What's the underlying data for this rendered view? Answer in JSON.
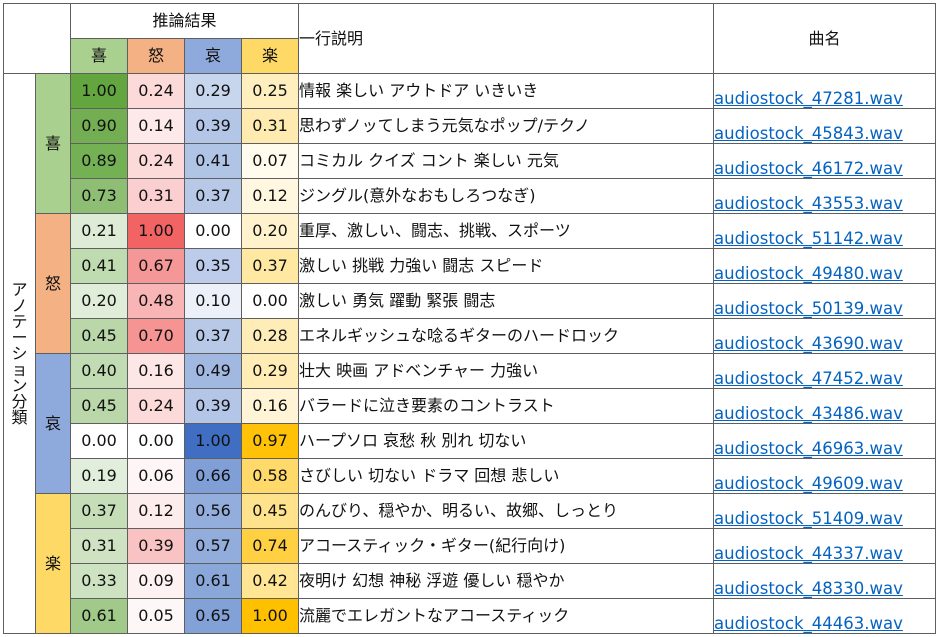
{
  "header": {
    "result_group": "推論結果",
    "emotions": [
      "喜",
      "怒",
      "哀",
      "楽"
    ],
    "description": "一行説明",
    "song": "曲名",
    "emotion_colors": [
      "#a9d08e",
      "#f4b183",
      "#8ea9db",
      "#ffd966"
    ]
  },
  "side_label": "アノテーション分類",
  "groups": [
    {
      "label": "喜",
      "color": "#a9d08e",
      "rows": [
        {
          "scores": [
            "1.00",
            "0.24",
            "0.29",
            "0.25"
          ],
          "description": "情報 楽しい アウトドア いきいき",
          "song": "audiostock_47281.wav"
        },
        {
          "scores": [
            "0.90",
            "0.14",
            "0.39",
            "0.31"
          ],
          "description": "思わずノッてしまう元気なポップ/テクノ",
          "song": "audiostock_45843.wav"
        },
        {
          "scores": [
            "0.89",
            "0.24",
            "0.41",
            "0.07"
          ],
          "description": "コミカル クイズ コント 楽しい 元気",
          "song": "audiostock_46172.wav"
        },
        {
          "scores": [
            "0.73",
            "0.31",
            "0.37",
            "0.12"
          ],
          "description": "ジングル(意外なおもしろつなぎ)",
          "song": "audiostock_43553.wav"
        }
      ]
    },
    {
      "label": "怒",
      "color": "#f4b183",
      "rows": [
        {
          "scores": [
            "0.21",
            "1.00",
            "0.00",
            "0.20"
          ],
          "description": "重厚、激しい、闘志、挑戦、スポーツ",
          "song": "audiostock_51142.wav"
        },
        {
          "scores": [
            "0.41",
            "0.67",
            "0.35",
            "0.37"
          ],
          "description": "激しい 挑戦 力強い 闘志 スピード",
          "song": "audiostock_49480.wav"
        },
        {
          "scores": [
            "0.20",
            "0.48",
            "0.10",
            "0.00"
          ],
          "description": "激しい 勇気 躍動 緊張 闘志",
          "song": "audiostock_50139.wav"
        },
        {
          "scores": [
            "0.45",
            "0.70",
            "0.37",
            "0.28"
          ],
          "description": "エネルギッシュな唸るギターのハードロック",
          "song": "audiostock_43690.wav"
        }
      ]
    },
    {
      "label": "哀",
      "color": "#8ea9db",
      "rows": [
        {
          "scores": [
            "0.40",
            "0.16",
            "0.49",
            "0.29"
          ],
          "description": "壮大 映画 アドベンチャー 力強い",
          "song": "audiostock_47452.wav"
        },
        {
          "scores": [
            "0.45",
            "0.24",
            "0.39",
            "0.16"
          ],
          "description": "バラードに泣き要素のコントラスト",
          "song": "audiostock_43486.wav"
        },
        {
          "scores": [
            "0.00",
            "0.00",
            "1.00",
            "0.97"
          ],
          "description": "ハープソロ 哀愁 秋 別れ 切ない",
          "song": "audiostock_46963.wav"
        },
        {
          "scores": [
            "0.19",
            "0.06",
            "0.66",
            "0.58"
          ],
          "description": "さびしい 切ない ドラマ 回想 悲しい",
          "song": "audiostock_49609.wav"
        }
      ]
    },
    {
      "label": "楽",
      "color": "#ffd966",
      "rows": [
        {
          "scores": [
            "0.37",
            "0.12",
            "0.56",
            "0.45"
          ],
          "description": "のんびり、穏やか、明るい、故郷、しっとり",
          "song": "audiostock_51409.wav"
        },
        {
          "scores": [
            "0.31",
            "0.39",
            "0.57",
            "0.74"
          ],
          "description": "アコースティック・ギター(紀行向け)",
          "song": "audiostock_44337.wav"
        },
        {
          "scores": [
            "0.33",
            "0.09",
            "0.61",
            "0.42"
          ],
          "description": "夜明け 幻想 神秘 浮遊 優しい 穏やか",
          "song": "audiostock_48330.wav"
        },
        {
          "scores": [
            "0.61",
            "0.05",
            "0.65",
            "1.00"
          ],
          "description": "流麗でエレガントなアコースティック",
          "song": "audiostock_44463.wav"
        }
      ]
    }
  ],
  "scale_colors": {
    "low": "#ffffff",
    "joy_high": "#63a63f",
    "anger_high": "#f26464",
    "sad_high": "#3f6ec2",
    "fun_high": "#ffc000"
  }
}
